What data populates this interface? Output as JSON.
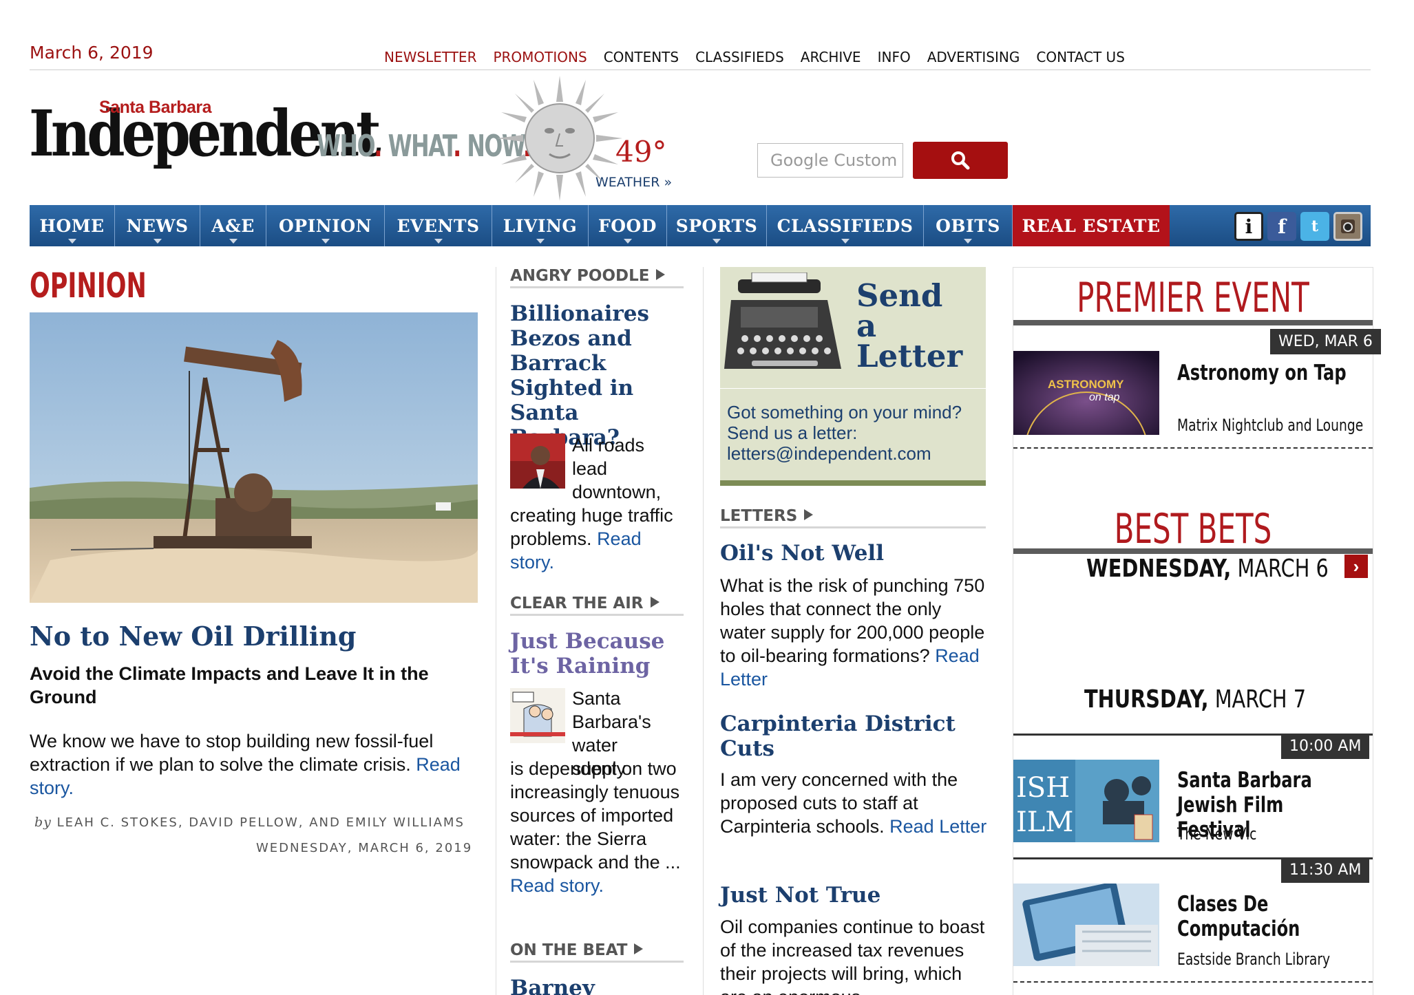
{
  "header": {
    "date": "March 6, 2019",
    "links": [
      {
        "label": "NEWSLETTER",
        "highlight": true
      },
      {
        "label": "PROMOTIONS",
        "highlight": true
      },
      {
        "label": "CONTENTS",
        "highlight": false
      },
      {
        "label": "CLASSIFIEDS",
        "highlight": false
      },
      {
        "label": "ARCHIVE",
        "highlight": false
      },
      {
        "label": "INFO",
        "highlight": false
      },
      {
        "label": "ADVERTISING",
        "highlight": false
      },
      {
        "label": "CONTACT US",
        "highlight": false
      }
    ]
  },
  "masthead": {
    "brand_small": "Santa Barbara",
    "brand": "Independent",
    "tagline": [
      "WHO",
      "WHAT",
      "NOW"
    ],
    "temperature": "49°",
    "weather_link": "WEATHER »",
    "search_placeholder": "Google Custom Search"
  },
  "nav": {
    "items": [
      "HOME",
      "NEWS",
      "A&E",
      "OPINION",
      "EVENTS",
      "LIVING",
      "FOOD",
      "SPORTS",
      "CLASSIFIEDS",
      "OBITS",
      "REAL ESTATE"
    ],
    "social_icons": [
      "info-icon",
      "facebook-icon",
      "twitter-icon",
      "instagram-icon"
    ]
  },
  "opinion": {
    "section_title": "OPINION",
    "headline": "No to New Oil Drilling",
    "dek": "Avoid the Climate Impacts and Leave It in the Ground",
    "summary": "We know we have to stop building new fossil-fuel extraction if we plan to solve the climate crisis.",
    "read_more": "Read story.",
    "by": "by",
    "authors": "LEAH C. STOKES, DAVID PELLOW, AND EMILY WILLIAMS",
    "published": "WEDNESDAY, MARCH 6, 2019"
  },
  "middle": {
    "angry_poodle": {
      "category": "ANGRY POODLE",
      "headline": "Billionaires Bezos and Barrack Sighted in Santa Barbara?",
      "summary": "All roads lead downtown, creating huge traffic problems.",
      "read_more": "Read story."
    },
    "clear_the_air": {
      "category": "CLEAR THE AIR",
      "headline": "Just Because It's Raining",
      "summary": "Santa Barbara's water supply is dependent on two increasingly tenuous sources of imported water: the Sierra snowpack and the ...",
      "read_more": "Read story."
    },
    "on_the_beat": {
      "category": "ON THE BEAT",
      "headline": "Barney"
    }
  },
  "letters": {
    "send_title": [
      "Send",
      "a",
      "Letter"
    ],
    "prompt": "Got something on your mind? Send us a letter: letters@independent.com",
    "category": "LETTERS",
    "items": [
      {
        "headline": "Oil's Not Well",
        "summary": "What is the risk of punching 750 holes that connect the only water supply for 200,000 people to oil-bearing formations?",
        "read_more": "Read Letter"
      },
      {
        "headline": "Carpinteria District Cuts",
        "summary": "I am very concerned with the proposed cuts to staff at Carpinteria schools.",
        "read_more": "Read Letter"
      },
      {
        "headline": "Just Not True",
        "summary": "Oil companies continue to boast of the increased tax revenues their projects will bring, which are an enormous",
        "read_more": ""
      }
    ]
  },
  "events": {
    "premier_title": "PREMIER EVENT",
    "premier_date": "WED, MAR 6",
    "premier_event": {
      "title": "Astronomy on Tap",
      "venue": "Matrix Nightclub and Lounge"
    },
    "best_bets_title": "BEST  BETS",
    "days": [
      {
        "weekday": "WEDNESDAY,",
        "date": "MARCH 6"
      },
      {
        "weekday": "THURSDAY,",
        "date": "MARCH 7"
      }
    ],
    "listings": [
      {
        "time": "10:00 AM",
        "title": "Santa Barbara Jewish Film Festival",
        "venue": "The New Vic"
      },
      {
        "time": "11:30 AM",
        "title": "Clases De Computación",
        "venue": "Eastside Branch Library"
      }
    ]
  },
  "colors": {
    "accent_red": "#b51d1d",
    "nav_blue": "#1b4d84",
    "link_blue": "#1a56a0",
    "headline_blue": "#1c3f6e"
  }
}
